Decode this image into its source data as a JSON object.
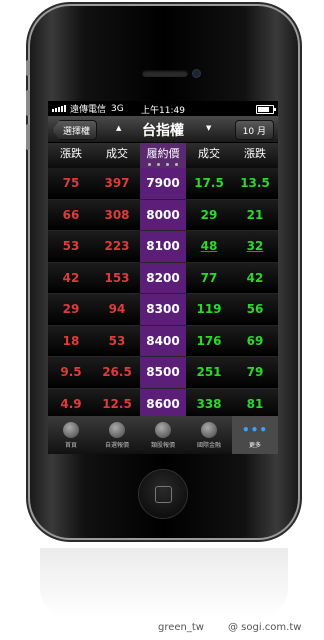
{
  "status_bar": {
    "carrier": "遠傳電信",
    "network": "3G",
    "time": "上午11:49"
  },
  "nav": {
    "back_label": "選擇權",
    "title": "台指權",
    "month_label": "10 月"
  },
  "table": {
    "headers": [
      "漲跌",
      "成交",
      "履約價",
      "成交",
      "漲跌"
    ],
    "rows": [
      [
        "75",
        "397",
        "7900",
        "17.5",
        "13.5"
      ],
      [
        "66",
        "308",
        "8000",
        "29",
        "21"
      ],
      [
        "53",
        "223",
        "8100",
        "48",
        "32"
      ],
      [
        "42",
        "153",
        "8200",
        "77",
        "42"
      ],
      [
        "29",
        "94",
        "8300",
        "119",
        "56"
      ],
      [
        "18",
        "53",
        "8400",
        "176",
        "69"
      ],
      [
        "9.5",
        "26.5",
        "8500",
        "251",
        "79"
      ],
      [
        "4.9",
        "12.5",
        "8600",
        "338",
        "81"
      ]
    ]
  },
  "tab_bar": {
    "items": [
      {
        "label": "首頁",
        "icon": "home-icon"
      },
      {
        "label": "自選報價",
        "icon": "custom-quotes-icon"
      },
      {
        "label": "類股報價",
        "icon": "sector-quotes-icon"
      },
      {
        "label": "國際金融",
        "icon": "globe-icon"
      },
      {
        "label": "更多",
        "icon": "more-icon",
        "selected": true
      }
    ]
  },
  "watermarks": {
    "left": "green_tw",
    "right": "@ sogi.com.tw"
  },
  "colors": {
    "strike_column": "#5b1f7a",
    "call_text": "#e03a3a",
    "put_text": "#2bd92b",
    "more_icon": "#3aa0ff"
  }
}
